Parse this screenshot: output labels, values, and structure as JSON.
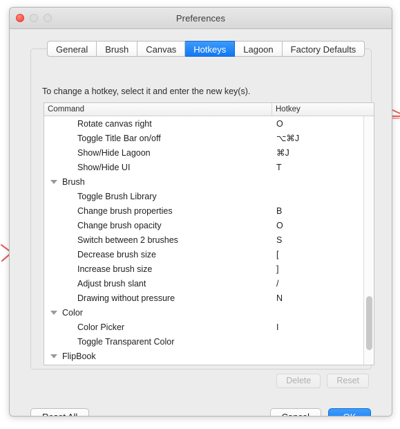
{
  "window": {
    "title": "Preferences",
    "controls": {
      "close": "close-button",
      "minimize": "minimize-button",
      "maximize": "maximize-button"
    }
  },
  "tabs": [
    {
      "label": "General",
      "active": false
    },
    {
      "label": "Brush",
      "active": false
    },
    {
      "label": "Canvas",
      "active": false
    },
    {
      "label": "Hotkeys",
      "active": true
    },
    {
      "label": "Lagoon",
      "active": false
    },
    {
      "label": "Factory Defaults",
      "active": false
    }
  ],
  "hint": "To change a hotkey, select it and enter the new key(s).",
  "list": {
    "columns": [
      "Command",
      "Hotkey"
    ],
    "rows": [
      {
        "type": "item",
        "command": "Rotate canvas right",
        "hotkey": "O"
      },
      {
        "type": "item",
        "command": "Toggle Title Bar on/off",
        "hotkey": "⌥⌘J"
      },
      {
        "type": "item",
        "command": "Show/Hide Lagoon",
        "hotkey": "⌘J"
      },
      {
        "type": "item",
        "command": "Show/Hide UI",
        "hotkey": "T"
      },
      {
        "type": "group",
        "command": "Brush",
        "hotkey": ""
      },
      {
        "type": "item",
        "command": "Toggle Brush Library",
        "hotkey": ""
      },
      {
        "type": "item",
        "command": "Change brush properties",
        "hotkey": "B"
      },
      {
        "type": "item",
        "command": "Change brush opacity",
        "hotkey": "O"
      },
      {
        "type": "item",
        "command": "Switch between 2 brushes",
        "hotkey": "S"
      },
      {
        "type": "item",
        "command": "Decrease brush size",
        "hotkey": "["
      },
      {
        "type": "item",
        "command": "Increase brush size",
        "hotkey": "]"
      },
      {
        "type": "item",
        "command": "Adjust brush slant",
        "hotkey": "/"
      },
      {
        "type": "item",
        "command": "Drawing without pressure",
        "hotkey": "N"
      },
      {
        "type": "group",
        "command": "Color",
        "hotkey": ""
      },
      {
        "type": "item",
        "command": "Color Picker",
        "hotkey": "I"
      },
      {
        "type": "item",
        "command": "Toggle Transparent Color",
        "hotkey": ""
      },
      {
        "type": "group",
        "command": "FlipBook",
        "hotkey": ""
      }
    ]
  },
  "buttons": {
    "delete": "Delete",
    "reset": "Reset",
    "reset_all": "Reset All",
    "cancel": "Cancel",
    "ok": "OK"
  },
  "colors": {
    "accent": "#1277f3",
    "window_bg": "#ececec",
    "list_bg": "#ffffff",
    "close_light": "#fc5d55",
    "annotation": "#e8625c"
  }
}
